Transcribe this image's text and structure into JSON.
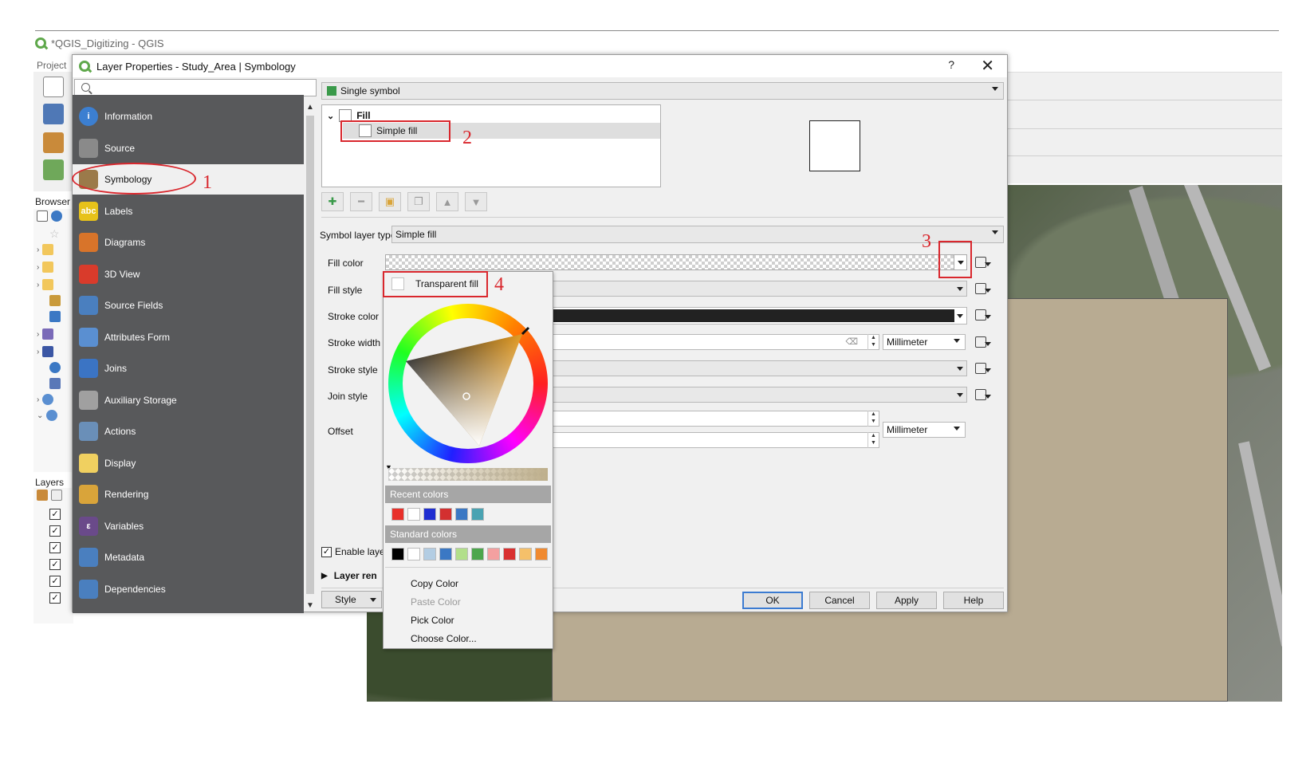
{
  "main_window": {
    "title": "*QGIS_Digitizing - QGIS",
    "menu_first": "Project",
    "browser_label": "Browser",
    "layers_label": "Layers"
  },
  "dialog": {
    "title": "Layer Properties - Study_Area | Symbology",
    "help": "?",
    "close": "✕"
  },
  "search": {
    "placeholder": ""
  },
  "nav_items": [
    {
      "label": "Information",
      "icon": "info-icon",
      "color": "#3c7fd1"
    },
    {
      "label": "Source",
      "icon": "wrench-icon",
      "color": "#8a8a8a"
    },
    {
      "label": "Symbology",
      "icon": "brush-icon",
      "color": "#9b7a4a"
    },
    {
      "label": "Labels",
      "icon": "abc-label-icon",
      "color": "#e7c21a"
    },
    {
      "label": "Diagrams",
      "icon": "diagram-icon",
      "color": "#d8742a"
    },
    {
      "label": "3D View",
      "icon": "cube-icon",
      "color": "#d93b2b"
    },
    {
      "label": "Source Fields",
      "icon": "fields-icon",
      "color": "#4a7fbf"
    },
    {
      "label": "Attributes Form",
      "icon": "form-icon",
      "color": "#5a8fd1"
    },
    {
      "label": "Joins",
      "icon": "joins-icon",
      "color": "#3b74c4"
    },
    {
      "label": "Auxiliary Storage",
      "icon": "database-icon",
      "color": "#a0a0a0"
    },
    {
      "label": "Actions",
      "icon": "gear-icon",
      "color": "#6a8fb8"
    },
    {
      "label": "Display",
      "icon": "speech-bubble-icon",
      "color": "#f0d060"
    },
    {
      "label": "Rendering",
      "icon": "paintbrush-icon",
      "color": "#d9a43a"
    },
    {
      "label": "Variables",
      "icon": "epsilon-icon",
      "color": "#6a4a8a"
    },
    {
      "label": "Metadata",
      "icon": "metadata-icon",
      "color": "#4a7fbf"
    },
    {
      "label": "Dependencies",
      "icon": "dependencies-icon",
      "color": "#4a7fbf"
    }
  ],
  "renderer": {
    "value": "Single symbol"
  },
  "symbol_tree": {
    "root": "Fill",
    "child": "Simple fill"
  },
  "symbol_layer_type": {
    "label": "Symbol layer type",
    "value": "Simple fill"
  },
  "properties": {
    "fill_color": "Fill color",
    "fill_style": "Fill style",
    "stroke_color": "Stroke color",
    "stroke_width": "Stroke width",
    "stroke_width_unit": "Millimeter",
    "stroke_style": "Stroke style",
    "join_style": "Join style",
    "offset": "Offset",
    "offset_unit": "Millimeter"
  },
  "enable_layer": "Enable layer",
  "layer_rendering": "Layer ren",
  "buttons": {
    "style": "Style",
    "ok": "OK",
    "cancel": "Cancel",
    "apply": "Apply",
    "help": "Help"
  },
  "color_menu": {
    "transparent_fill": "Transparent fill",
    "recent_header": "Recent colors",
    "recent_colors": [
      "#e8302a",
      "#ffffff",
      "#1f2ed1",
      "#d33030",
      "#3b78c4",
      "#4aa3b2"
    ],
    "standard_header": "Standard colors",
    "standard_colors": [
      "#000000",
      "#ffffff",
      "#b3cde3",
      "#3b78c4",
      "#b2df8a",
      "#4ca64c",
      "#f4a0a0",
      "#d93030",
      "#f5c06a",
      "#f08a30"
    ],
    "copy_color": "Copy Color",
    "paste_color": "Paste Color",
    "pick_color": "Pick Color",
    "choose_color": "Choose Color..."
  },
  "annotations": {
    "n1": "1",
    "n2": "2",
    "n3": "3",
    "n4": "4",
    "color": "#d9272d"
  }
}
